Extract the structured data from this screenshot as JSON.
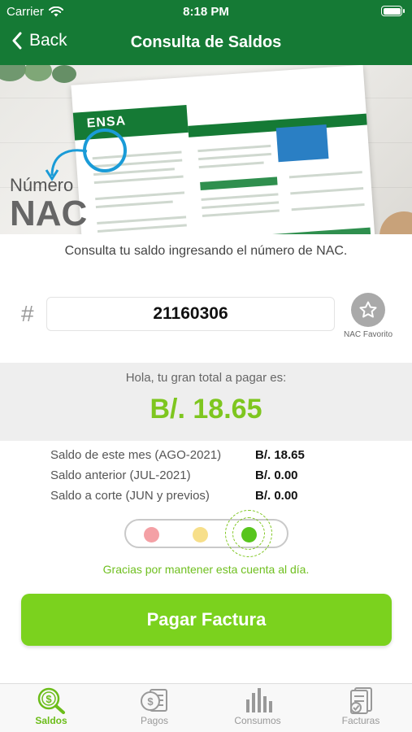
{
  "status_bar": {
    "carrier": "Carrier",
    "time": "8:18 PM"
  },
  "nav": {
    "back_label": "Back",
    "title": "Consulta de Saldos"
  },
  "banner": {
    "nac_word1": "Número",
    "nac_word2": "NAC",
    "brand": "ENSA"
  },
  "subtitle": "Consulta tu saldo ingresando el número de NAC.",
  "nac_input": {
    "value": "21160306",
    "hash_symbol": "#"
  },
  "favorite": {
    "label": "NAC Favorito",
    "icon": "star-icon"
  },
  "total": {
    "heading": "Hola, tu gran total a pagar es:",
    "amount": "B/. 18.65"
  },
  "details": [
    {
      "label": "Saldo de este mes (AGO-2021)",
      "value": "B/. 18.65"
    },
    {
      "label": "Saldo anterior (JUL-2021)",
      "value": "B/. 0.00"
    },
    {
      "label": "Saldo a corte (JUN y previos)",
      "value": "B/. 0.00"
    }
  ],
  "status_indicator": {
    "active": "green",
    "colors": {
      "red": "#f4a0a5",
      "yellow": "#f7df8a",
      "green": "#58c51d"
    }
  },
  "message": "Gracias por mantener esta cuenta al día.",
  "pay_button": "Pagar Factura",
  "tabs": [
    {
      "label": "Saldos",
      "icon": "balance-search-icon",
      "active": true
    },
    {
      "label": "Pagos",
      "icon": "payments-icon",
      "active": false
    },
    {
      "label": "Consumos",
      "icon": "consumption-chart-icon",
      "active": false
    },
    {
      "label": "Facturas",
      "icon": "invoices-icon",
      "active": false
    }
  ],
  "colors": {
    "header": "#157a35",
    "accent": "#7bd21e",
    "amount": "#7ec61f"
  }
}
